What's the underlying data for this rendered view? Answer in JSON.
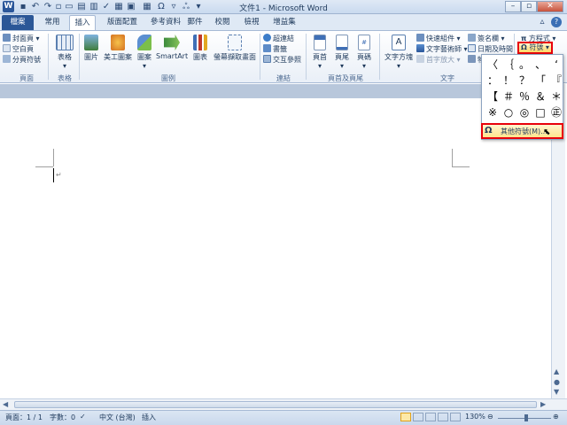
{
  "window": {
    "title": "文件1 - Microsoft Word"
  },
  "tabs": [
    "檔案",
    "常用",
    "插入",
    "版面配置",
    "參考資料",
    "郵件",
    "校閱",
    "檢視",
    "增益集"
  ],
  "ribbon": {
    "pages": {
      "cover": "封面頁",
      "blank": "空白頁",
      "break": "分頁符號",
      "label": "頁面"
    },
    "tables": {
      "table": "表格",
      "label": "表格"
    },
    "illustrations": {
      "picture": "圖片",
      "clipart": "美工圖案",
      "shapes": "圖案",
      "smartart": "SmartArt",
      "chart": "圖表",
      "screenshot": "螢幕擷取畫面",
      "label": "圖例"
    },
    "links": {
      "hyperlink": "超連結",
      "bookmark": "書籤",
      "crossref": "交互參照",
      "label": "連結"
    },
    "headerfooter": {
      "header": "頁首",
      "footer": "頁尾",
      "pagenum": "頁碼",
      "label": "頁首及頁尾"
    },
    "text": {
      "textbox": "文字方塊",
      "quickparts": "快速組件",
      "wordart": "文字藝術師",
      "dropcap": "首字放大",
      "signature": "簽名欄",
      "datetime": "日期及時間",
      "object": "物",
      "label": "文字"
    },
    "symbols": {
      "equation": "方程式",
      "symbol": "符號"
    }
  },
  "symbol_dropdown": {
    "symbols": [
      "〈",
      "｛",
      "。",
      "、",
      "‘",
      "：",
      "！",
      "？",
      "「",
      "『",
      "【",
      "＃",
      "％",
      "＆",
      "＊",
      "※",
      "○",
      "◎",
      "□",
      "㊣"
    ],
    "more_label": "其他符號(M)..."
  },
  "statusbar": {
    "page": "頁面：1 / 1",
    "words": "字數：0",
    "language": "中文 (台灣)",
    "mode": "插入",
    "zoom": "130%"
  },
  "colors": {
    "file_tab": "#2b5797",
    "highlight": "#e8000b"
  }
}
